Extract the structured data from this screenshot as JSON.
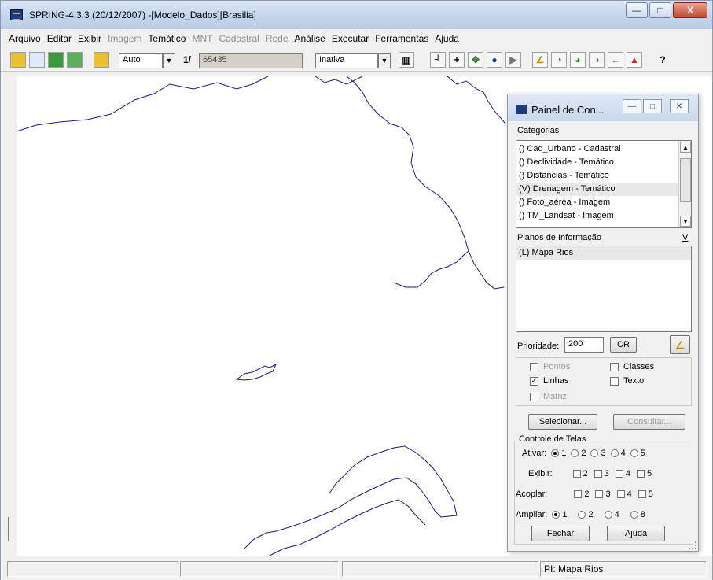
{
  "window": {
    "title": "SPRING-4.3.3 (20/12/2007) -[Modelo_Dados][Brasilia]",
    "minimize": "—",
    "maximize": "□",
    "close": "X"
  },
  "menu": [
    {
      "label": "Arquivo",
      "enabled": true
    },
    {
      "label": "Editar",
      "enabled": true
    },
    {
      "label": "Exibir",
      "enabled": true
    },
    {
      "label": "Imagem",
      "enabled": false
    },
    {
      "label": "Temático",
      "enabled": true
    },
    {
      "label": "MNT",
      "enabled": false
    },
    {
      "label": "Cadastral",
      "enabled": false
    },
    {
      "label": "Rede",
      "enabled": false
    },
    {
      "label": "Análise",
      "enabled": true
    },
    {
      "label": "Executar",
      "enabled": true
    },
    {
      "label": "Ferramentas",
      "enabled": true
    },
    {
      "label": "Ajuda",
      "enabled": true
    }
  ],
  "toolbar": {
    "zoom_mode": "Auto",
    "scale_prefix": "1/",
    "scale_value": "65435",
    "cursor_mode": "Inativa",
    "help_glyph": "?"
  },
  "panel": {
    "title": "Painel de Con...",
    "categories_label": "Categorias",
    "categories": [
      "() Cad_Urbano - Cadastral",
      "() Declividade - Temático",
      "() Distancias - Temático",
      "(V) Drenagem - Temático",
      "() Foto_aérea - Imagem",
      "() TM_Landsat - Imagem"
    ],
    "selected_category_index": 3,
    "planes_label": "Planos de Informação",
    "planes_toggle": "V",
    "planes": [
      "(L) Mapa Rios"
    ],
    "priority_label": "Prioridade:",
    "priority_value": "200",
    "cr_button": "CR",
    "checks": {
      "pontos": "Pontos",
      "classes": "Classes",
      "linhas": "Linhas",
      "texto": "Texto",
      "matriz": "Matriz"
    },
    "select_button": "Selecionar...",
    "query_button": "Consultar...",
    "screen_control_label": "Controle de Telas",
    "ativar_label": "Ativar:",
    "exibir_label": "Exibir:",
    "acoplar_label": "Acoplar:",
    "ampliar_label": "Ampliar:",
    "ativar_options": [
      "1",
      "2",
      "3",
      "4",
      "5"
    ],
    "screen_numbers": [
      "2",
      "3",
      "4",
      "5"
    ],
    "ampliar_options": [
      "1",
      "2",
      "4",
      "8"
    ],
    "close_button": "Fechar",
    "help_button": "Ajuda"
  },
  "status": {
    "plane": "PI: Mapa Rios"
  }
}
